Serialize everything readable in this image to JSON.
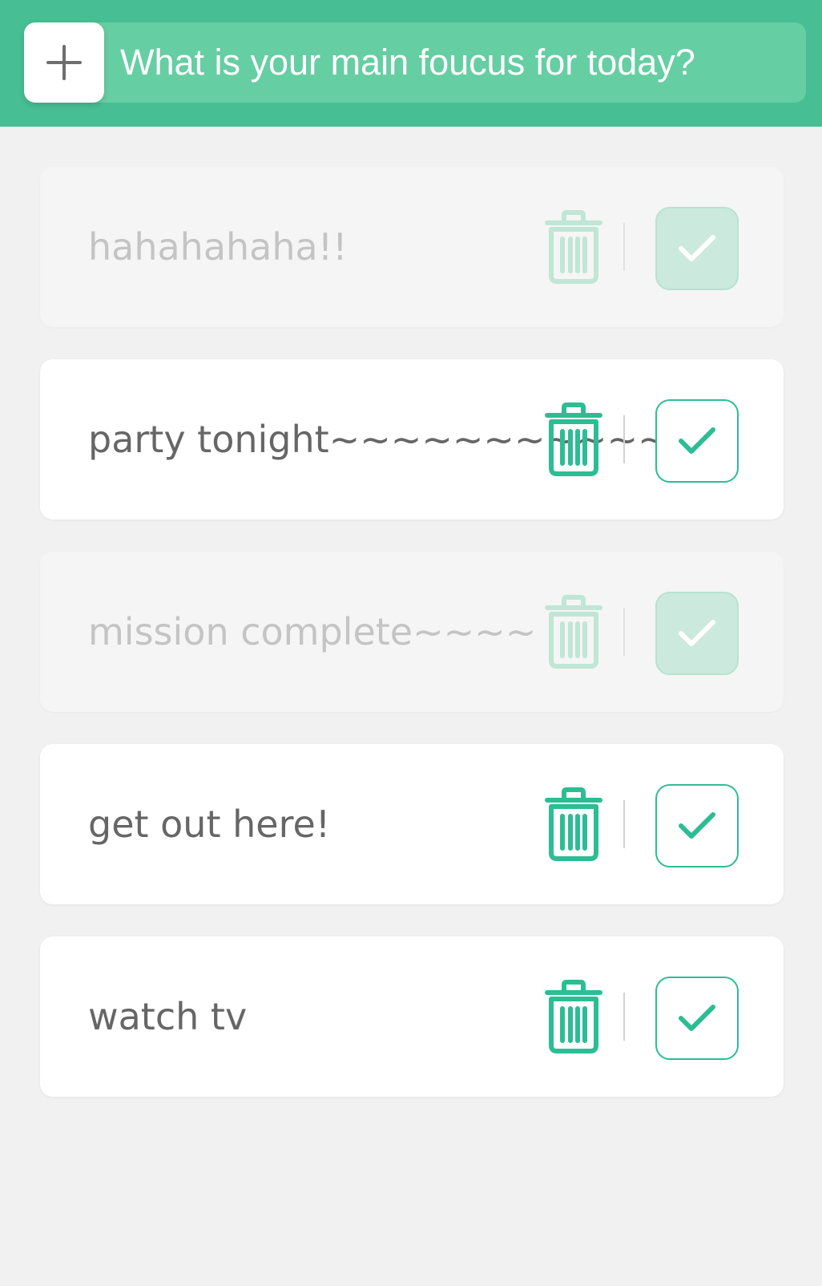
{
  "header": {
    "input_placeholder": "What is your main foucus for today?",
    "input_value": "",
    "add_icon": "plus-icon"
  },
  "colors": {
    "header_bg": "#47be94",
    "input_bar_bg": "#66cea3",
    "accent": "#2dbd94",
    "accent_faded": "#bfe6d6",
    "done_check_bg": "#cbe9dc",
    "page_bg": "#f1f1f1"
  },
  "todos": [
    {
      "text": "hahahahaha!!",
      "completed": true
    },
    {
      "text": "party tonight~~~~~~~~~~~~",
      "completed": false
    },
    {
      "text": "mission complete~~~~",
      "completed": true
    },
    {
      "text": "get out here!",
      "completed": false
    },
    {
      "text": "watch tv",
      "completed": false
    }
  ],
  "icons": {
    "delete": "trash-icon",
    "complete": "check-icon"
  }
}
